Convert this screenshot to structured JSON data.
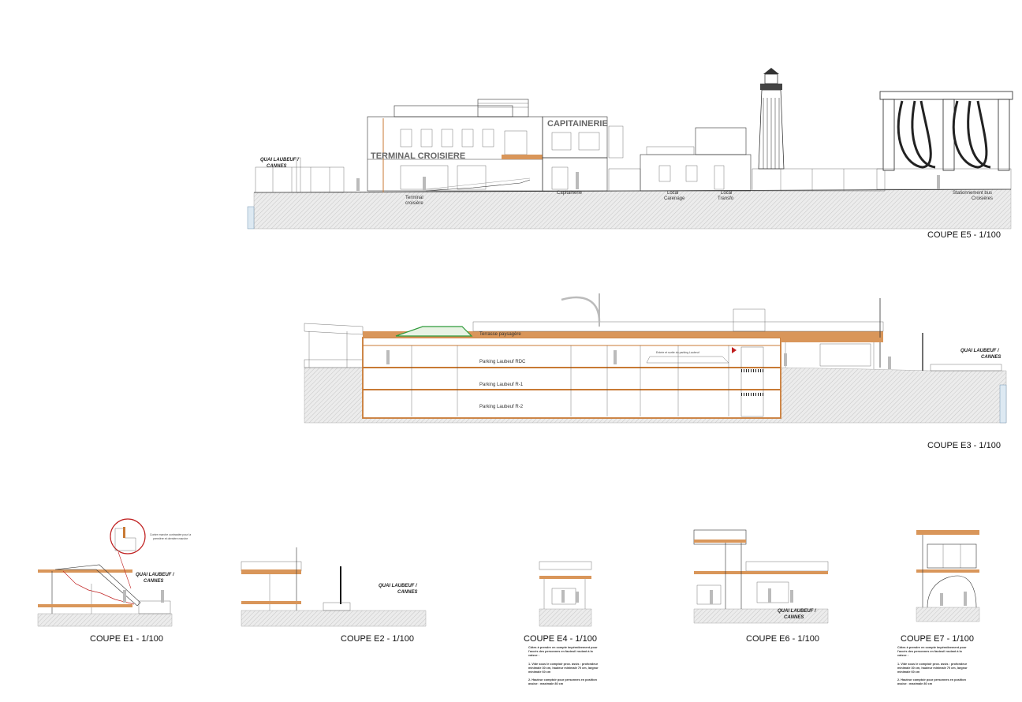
{
  "sections": {
    "e5": {
      "caption": "COUPE E5 - 1/100",
      "quai": [
        "QUAI LAUBEUF /",
        "CANNES"
      ],
      "signs": {
        "capitainerie": "CAPITAINERIE",
        "terminal": "TERMINAL CROISIERE"
      },
      "labels": {
        "terminal_1": "Terminal",
        "terminal_2": "croisière",
        "capitainerie": "Capitainerie",
        "local_carenage_1": "Local",
        "local_carenage_2": "Carenage",
        "local_transfo_1": "Local",
        "local_transfo_2": "Transfo",
        "bus_1": "Stationnement bus",
        "bus_2": "Croisières"
      }
    },
    "e3": {
      "caption": "COUPE E3 - 1/100",
      "quai": [
        "QUAI LAUBEUF /",
        "CANNES"
      ],
      "labels": {
        "terrasse": "Terrasse paysagère",
        "parking_rdc": "Parking Laubeuf RDC",
        "parking_r1": "Parking Laubeuf R-1",
        "parking_r2": "Parking Laubeuf R-2",
        "entree": "Entrée et sortie du parking Laubeuf"
      }
    },
    "e1": {
      "caption": "COUPE E1 - 1/100",
      "quai": [
        "QUAI LAUBEUF /",
        "CANNES"
      ],
      "detail_note_1": "Contre marche contrastée pour la",
      "detail_note_2": "première et dernière marche"
    },
    "e2": {
      "caption": "COUPE E2 - 1/100",
      "quai": [
        "QUAI LAUBEUF /",
        "CANNES"
      ]
    },
    "e4": {
      "caption": "COUPE E4 - 1/100",
      "notes": [
        "Côtes à prendre en compte impérativement pour",
        "l'accès des personnes en fauteuil roulant à la",
        "caisse :",
        "1. Vide sous le comptoir prox. assis : profondeur",
        "minimale 30 cm, hauteur minimale 70 cm, largeur",
        "minimale 60 cm",
        "2. Hauteur comptoir pour personnes en position",
        "assise : maximale 80 cm"
      ]
    },
    "e6": {
      "caption": "COUPE E6 - 1/100",
      "quai": [
        "QUAI LAUBEUF /",
        "CANNES"
      ]
    },
    "e7": {
      "caption": "COUPE E7 - 1/100",
      "notes": [
        "Côtes à prendre en compte impérativement pour",
        "l'accès des personnes en fauteuil roulant à la",
        "caisse :",
        "1. Vide sous le comptoir prox. assis : profondeur",
        "minimale 30 cm, hauteur minimale 70 cm, largeur",
        "minimale 60 cm",
        "2. Hauteur comptoir pour personnes en position",
        "assise : maximale 80 cm"
      ]
    }
  }
}
